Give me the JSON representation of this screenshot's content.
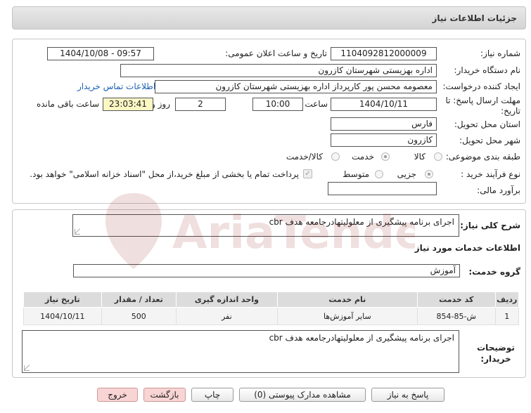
{
  "header": {
    "title": "جزئیات اطلاعات نیاز"
  },
  "form": {
    "need_number_label": "شماره نیاز:",
    "need_number": "1104092812000009",
    "announce_label": "تاریخ و ساعت اعلان عمومی:",
    "announce_value": "1404/10/08 - 09:57",
    "buyer_org_label": "نام دستگاه خریدار:",
    "buyer_org": "اداره بهزیستی شهرستان کازرون",
    "creator_label": "ایجاد کننده درخواست:",
    "creator": "معصومه محسن پور کارپرداز اداره بهزیستی شهرستان کازرون",
    "contact_link": "اطلاعات تماس خریدار",
    "deadline_label": "مهلت ارسال پاسخ: تا تاریخ:",
    "deadline_date": "1404/10/11",
    "time_label": "ساعت",
    "deadline_time": "10:00",
    "days_value": "2",
    "days_label": "روز و",
    "remaining_time": "23:03:41",
    "remaining_label": "ساعت باقی مانده",
    "province_label": "استان محل تحویل:",
    "province": "فارس",
    "city_label": "شهر محل تحویل:",
    "city": "کازرون",
    "category_label": "طبقه بندی موضوعی:",
    "category_options": [
      "کالا",
      "خدمت",
      "کالا/خدمت"
    ],
    "category_selected": "خدمت",
    "process_label": "نوع فرآیند خرید :",
    "process_options": [
      "جزیی",
      "متوسط"
    ],
    "process_selected": "جزیی",
    "payment_note": "پرداخت تمام یا بخشی از مبلغ خرید،از محل \"اسناد خزانه اسلامی\" خواهد بود.",
    "financial_label": "برآورد مالی:",
    "financial_value": ""
  },
  "description": {
    "label": "شرح کلی نیاز:",
    "value": "اجرای برنامه پیشگیری از معلولیتهادرجامعه هدف cbr"
  },
  "services": {
    "section_title": "اطلاعات خدمات مورد نیاز",
    "group_label": "گروه خدمت:",
    "group_value": "آموزش",
    "table": {
      "headers": [
        "ردیف",
        "کد خدمت",
        "نام خدمت",
        "واحد اندازه گیری",
        "تعداد / مقدار",
        "تاریخ نیاز"
      ],
      "rows": [
        [
          "1",
          "ش-85-854",
          "سایر آموزش‌ها",
          "نفر",
          "500",
          "1404/10/11"
        ]
      ]
    }
  },
  "buyer_notes": {
    "label": "توضیحات خریدار:",
    "value": "اجرای برنامه پیشگیری از معلولیتهادرجامعه هدف cbr"
  },
  "buttons": {
    "reply": "پاسخ به نیاز",
    "attachments": "مشاهده مدارک پیوستی (0)",
    "print": "چاپ",
    "back": "بازگشت",
    "exit": "خروج"
  },
  "watermark": {
    "brand": "AriaTender.neT"
  },
  "colors": {
    "link": "#1a5fb4",
    "deadline_highlight": "#fdf7c3",
    "pink_button": "#f9d4d4"
  }
}
